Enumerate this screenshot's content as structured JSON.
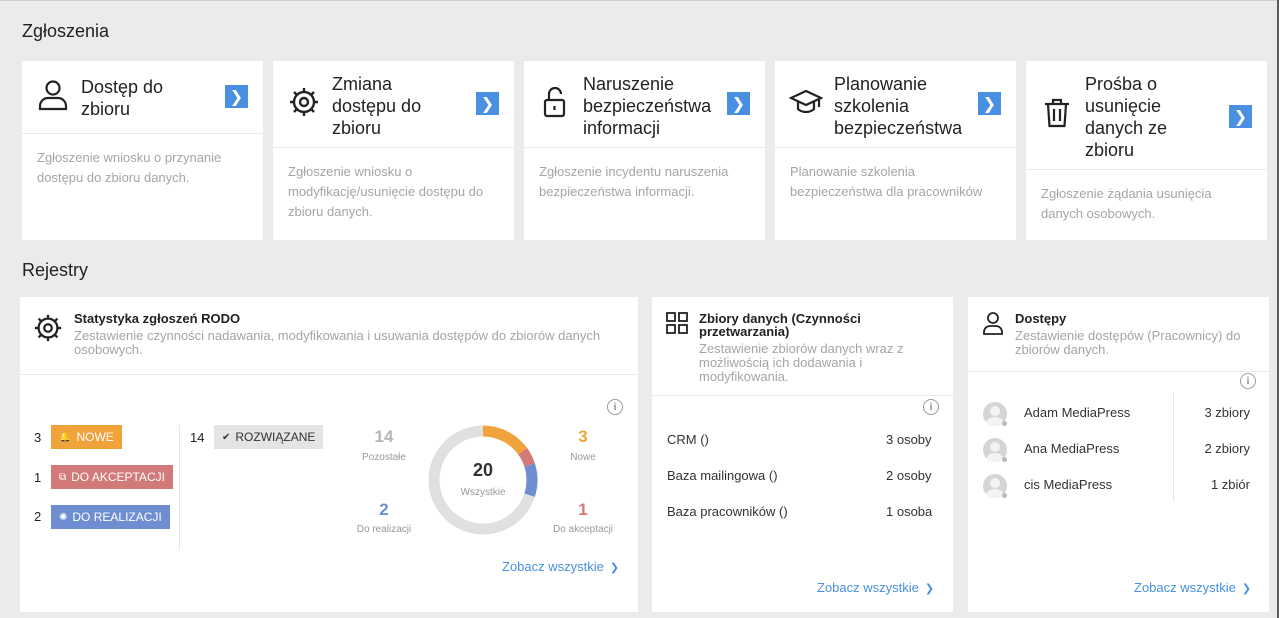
{
  "sections": {
    "zgloszenia": "Zgłoszenia",
    "rejestry": "Rejestry"
  },
  "tiles": [
    {
      "title": "Dostęp do zbioru",
      "desc": "Zgłoszenie wniosku o przynanie dostępu do zbioru danych.",
      "icon": "user-icon"
    },
    {
      "title": "Zmiana dostępu do zbioru",
      "desc": "Zgłoszenie wniosku o modyfikację/usunięcie dostępu do zbioru danych.",
      "icon": "gear-icon"
    },
    {
      "title": "Naruszenie bezpieczeństwa informacji",
      "desc": "Zgłoszenie incydentu naruszenia bezpieczeństwa informacji.",
      "icon": "unlock-icon"
    },
    {
      "title": "Planowanie szkolenia bezpieczeństwa",
      "desc": "Planowanie szkolenia bezpieczeństwa dla pracowników",
      "icon": "graduation-cap-icon"
    },
    {
      "title": "Prośba o usunięcie danych ze zbioru",
      "desc": "Zgłoszenie żądania usunięcia danych osobowych.",
      "icon": "trash-icon"
    }
  ],
  "stats": {
    "title": "Statystyka zgłoszeń RODO",
    "subtitle": "Zestawienie czynności nadawania, modyfikowania i usuwania dostępów do zbiorów danych osobowych.",
    "rows": [
      {
        "count": "3",
        "label": "NOWE",
        "color": "#f0a23b"
      },
      {
        "count": "1",
        "label": "DO AKCEPTACJI",
        "color": "#d27a7a"
      },
      {
        "count": "2",
        "label": "DO REALIZACJI",
        "color": "#6f8ed1"
      }
    ],
    "resolved": {
      "count": "14",
      "label": "ROZWIĄZANE"
    },
    "donut": {
      "total": "20",
      "total_label": "Wszystkie",
      "segments": [
        {
          "name": "Nowe",
          "value": 3,
          "color": "#f0a23b"
        },
        {
          "name": "Do akceptacji",
          "value": 1,
          "color": "#d27a7a"
        },
        {
          "name": "Do realizacji",
          "value": 2,
          "color": "#6f8ed1"
        },
        {
          "name": "Pozostałe",
          "value": 14,
          "color": "#e0e0e0"
        }
      ]
    },
    "labels": {
      "pozostale": {
        "num": "14",
        "text": "Pozostałe",
        "color": "#b5b5b5"
      },
      "nowe": {
        "num": "3",
        "text": "Nowe",
        "color": "#f0a23b"
      },
      "do_realizacji": {
        "num": "2",
        "text": "Do realizacji",
        "color": "#6f8ed1"
      },
      "do_akceptacji": {
        "num": "1",
        "text": "Do akceptacji",
        "color": "#d27a7a"
      }
    },
    "link": "Zobacz wszystkie"
  },
  "zbiory": {
    "title": "Zbiory danych (Czynności przetwarzania)",
    "subtitle": "Zestawienie zbiorów danych wraz z możliwością ich dodawania i modyfikowania.",
    "rows": [
      {
        "name": "CRM ()",
        "value": "3 osoby"
      },
      {
        "name": "Baza mailingowa ()",
        "value": "2 osoby"
      },
      {
        "name": "Baza pracowników ()",
        "value": "1 osoba"
      }
    ],
    "link": "Zobacz wszystkie"
  },
  "dostepy": {
    "title": "Dostępy",
    "subtitle": "Zestawienie dostępów (Pracownicy) do zbiorów danych.",
    "rows": [
      {
        "name": "Adam MediaPress",
        "value": "3 zbiory"
      },
      {
        "name": "Ana MediaPress",
        "value": "2 zbiory"
      },
      {
        "name": "cis MediaPress",
        "value": "1 zbiór"
      }
    ],
    "link": "Zobacz wszystkie"
  }
}
